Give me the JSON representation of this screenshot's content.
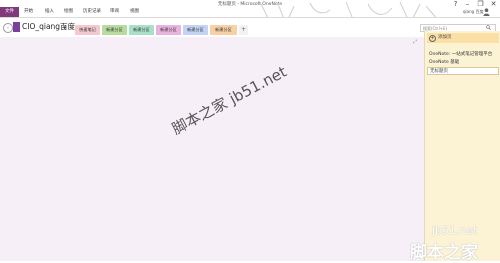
{
  "window": {
    "title": "无标题页 - Microsoft OneNote",
    "controls": {
      "help": "?",
      "minimize": "–",
      "restore": "❐",
      "close": "✕"
    }
  },
  "ribbon": {
    "file_tab": "文件",
    "tabs": [
      "开始",
      "插入",
      "绘图",
      "历史记录",
      "审阅",
      "视图"
    ],
    "user_name": "qiang 百度",
    "file_tab_color": "#80397b"
  },
  "notebook": {
    "name": "CIO_qiang百度",
    "dropdown_icon": "▼",
    "back_icon": "‹",
    "sections": [
      {
        "label": "快速笔记",
        "color": "#f5c8d0",
        "active": true
      },
      {
        "label": "新建分区",
        "color": "#b7dc9d"
      },
      {
        "label": "新建分区",
        "color": "#a9e0c7"
      },
      {
        "label": "新建分区",
        "color": "#e9b3e0"
      },
      {
        "label": "新建分区",
        "color": "#c3d3f3"
      },
      {
        "label": "新建分区",
        "color": "#f7d1a5"
      }
    ],
    "add_section": "+"
  },
  "search": {
    "placeholder": "搜索(Ctrl+E)"
  },
  "page_area": {
    "background": "#f6eff7"
  },
  "pages": {
    "add_page_label": "添加页",
    "items": [
      "OneNote: 一站式笔记管理平台",
      "OneNote 基础"
    ],
    "selected_page": "无标题页",
    "pane_color": "#fcf3d5"
  },
  "watermarks": {
    "diagonal": "脚本之家 jb51.net",
    "corner_site": "jb51.net",
    "corner_name": "脚本之家"
  }
}
